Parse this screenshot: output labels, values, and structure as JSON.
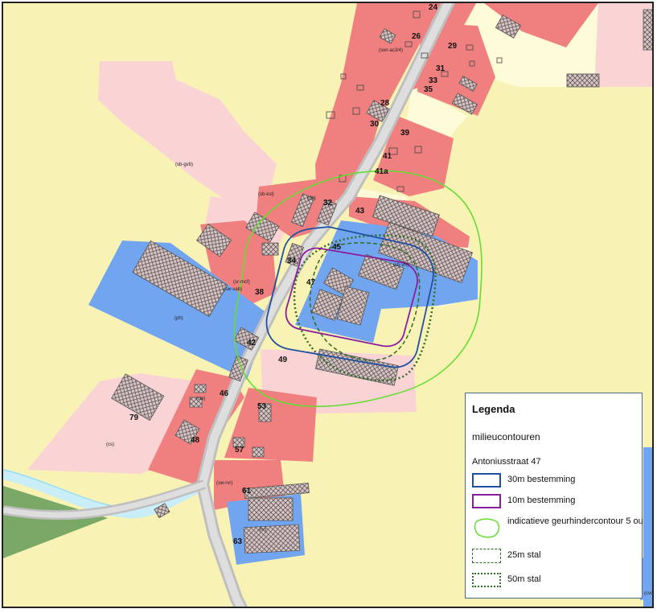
{
  "house_numbers": [
    "24",
    "26",
    "29",
    "31",
    "33",
    "35",
    "28",
    "30",
    "39",
    "41",
    "41a",
    "32",
    "43",
    "45",
    "34",
    "47",
    "38",
    "42",
    "49",
    "46",
    "53",
    "79",
    "48",
    "57",
    "61",
    "63"
  ],
  "zone_codes": [
    "(swr-ac3/4)",
    "(sb-gvb)",
    "(sb-ksl)",
    "(dh)",
    "(sb-vrf)",
    "(sr-mcf)",
    "(sw-vab)",
    "(ph)",
    "(cw)",
    "(cs)",
    "(sw-rvr)",
    "(hr)",
    "(cvc)"
  ],
  "legend": {
    "title": "Legenda",
    "section": "milieucontouren",
    "subtitle": "Antoniusstraat 47",
    "items": [
      {
        "label": "30m bestemming",
        "color": "#1f4fa0",
        "style": "solid"
      },
      {
        "label": "10m bestemming",
        "color": "#8a1d9c",
        "style": "solid"
      },
      {
        "label": "indicatieve geurhindercontour 5 ou",
        "color": "#66dd33",
        "style": "freeform"
      },
      {
        "label": "25m stal",
        "color": "#2e6b24",
        "style": "dashed"
      },
      {
        "label": "50m stal",
        "color": "#2e6b24",
        "style": "dotted"
      }
    ]
  },
  "colors": {
    "background": "#f8f2b4",
    "residential": "#f08080",
    "garden": "#fad4d4",
    "agricultural_light": "#fdfbd8",
    "business": "#72a5f0",
    "meadow": "#7aa866",
    "water": "#c9eef8",
    "road": "#c8c8c8"
  }
}
